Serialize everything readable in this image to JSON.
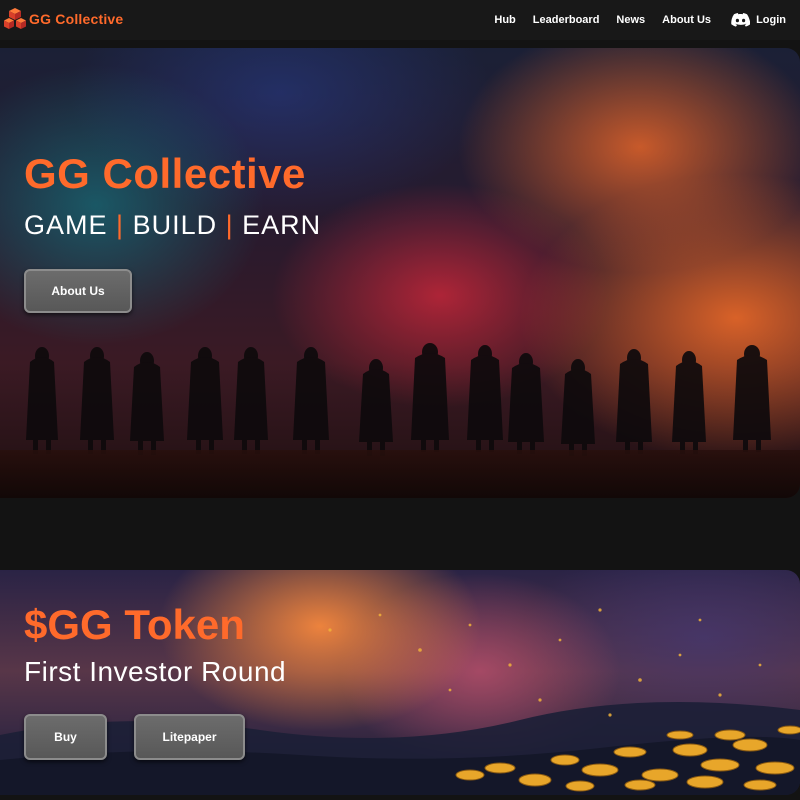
{
  "nav": {
    "brand": "GG Collective",
    "links": [
      "Hub",
      "Leaderboard",
      "News",
      "About Us"
    ],
    "login_label": "Login"
  },
  "hero": {
    "title": "GG Collective",
    "tagline_parts": [
      "GAME",
      "BUILD",
      "EARN"
    ],
    "separator": "|",
    "button_label": "About Us"
  },
  "token": {
    "title": "$GG Token",
    "subtitle": "First Investor Round",
    "buy_label": "Buy",
    "litepaper_label": "Litepaper"
  },
  "colors": {
    "accent": "#ff6a2b",
    "background": "#131313",
    "navbar": "#181818",
    "button": "#666666"
  },
  "icons": {
    "logo": "red-cube-cluster-icon",
    "login": "discord-icon"
  }
}
